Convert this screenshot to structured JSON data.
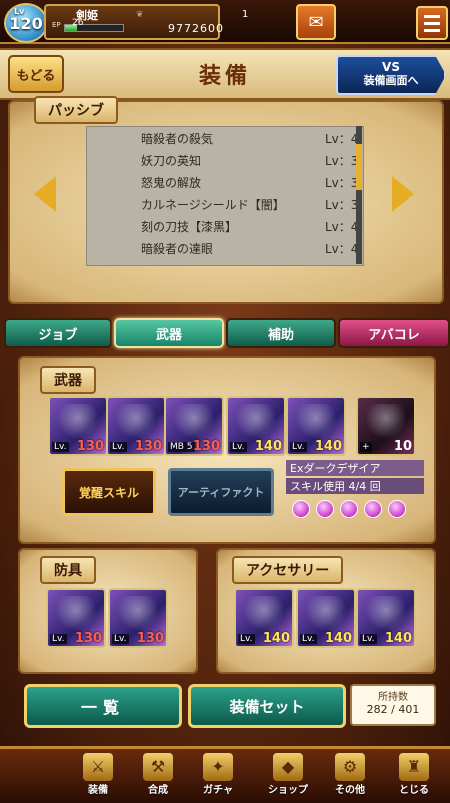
{
  "status": {
    "level": "120",
    "level_prefix": "Lv",
    "player_name": "剣姫",
    "ep_label": "EP",
    "ep_value": "26",
    "ep_fill": 0.2,
    "gems": "1",
    "money": "9772600"
  },
  "header": {
    "back_label": "もどる",
    "title": "装備",
    "vs_line1": "VS",
    "vs_line2": "装備画面へ"
  },
  "passive": {
    "section_label": "パッシブ",
    "skills": [
      {
        "name": "暗殺者の殺気",
        "level": "Lv：4"
      },
      {
        "name": "妖刀の英知",
        "level": "Lv：3"
      },
      {
        "name": "怒鬼の解放",
        "level": "Lv：3"
      },
      {
        "name": "カルネージシールド【闇】",
        "level": "Lv：3"
      },
      {
        "name": "刻の刀技【漆黒】",
        "level": "Lv：4"
      },
      {
        "name": "暗殺者の達眼",
        "level": "Lv：4"
      }
    ]
  },
  "tabs": [
    {
      "label": "ジョブ"
    },
    {
      "label": "武器"
    },
    {
      "label": "補助"
    },
    {
      "label": "アバコレ"
    }
  ],
  "weapons": {
    "section_label": "武器",
    "cards": [
      {
        "lv_tag": "Lv.",
        "level": "130"
      },
      {
        "lv_tag": "Lv.",
        "level": "130"
      },
      {
        "lv_tag": "MB 5",
        "level": "130"
      },
      {
        "lv_tag": "Lv.",
        "level": "140"
      },
      {
        "lv_tag": "Lv.",
        "level": "140"
      },
      {
        "lv_tag": "+",
        "level": "10"
      }
    ],
    "awaken_label": "覚醒スキル",
    "artifact_label": "アーティファクト",
    "ex_name": "Exダークデザイア",
    "ex_use": "スキル使用 4/4 回"
  },
  "armor": {
    "section_label": "防具",
    "cards": [
      {
        "lv_tag": "Lv.",
        "level": "130"
      },
      {
        "lv_tag": "Lv.",
        "level": "130"
      }
    ]
  },
  "accessory": {
    "section_label": "アクセサリー",
    "cards": [
      {
        "lv_tag": "Lv.",
        "level": "140"
      },
      {
        "lv_tag": "Lv.",
        "level": "140"
      },
      {
        "lv_tag": "Lv.",
        "level": "140"
      }
    ]
  },
  "actions": {
    "list_label": "一覧",
    "set_label": "装備セット",
    "count_label": "所持数",
    "count_value": "282 / 401"
  },
  "nav": [
    {
      "label": "装備",
      "icon": "sword-icon"
    },
    {
      "label": "合成",
      "icon": "hammer-icon"
    },
    {
      "label": "ガチャ",
      "icon": "gacha-icon"
    },
    {
      "label": "ショップ",
      "icon": "crystal-icon"
    },
    {
      "label": "その他",
      "icon": "gear-icon"
    },
    {
      "label": "とじる",
      "icon": "pouch-icon"
    }
  ]
}
